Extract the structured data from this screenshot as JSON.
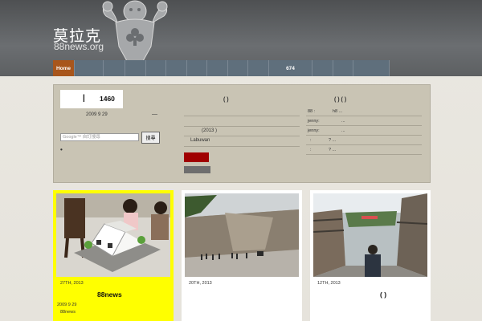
{
  "site": {
    "name_cn": "莫拉克",
    "name_en": "88news.org"
  },
  "nav": {
    "items": [
      {
        "label": "Home",
        "active": true
      },
      {
        "label": ""
      },
      {
        "label": ""
      },
      {
        "label": ""
      },
      {
        "label": ""
      },
      {
        "label": ""
      },
      {
        "label": ""
      },
      {
        "label": ""
      },
      {
        "label": ""
      },
      {
        "label": ""
      },
      {
        "label": "674"
      },
      {
        "label": ""
      },
      {
        "label": ""
      },
      {
        "label": ""
      }
    ]
  },
  "feature": {
    "counter_bar": "|",
    "counter_value": "1460",
    "date": "2009 9 29",
    "dash": "—",
    "search_placeholder": "Google™ 自訂搜尋",
    "search_button": "搜尋",
    "dot": "•",
    "mid_title": "(    )",
    "mid_line1": "(2013       )",
    "mid_line2": "Labuwan",
    "right_title": "(    ) (    )",
    "right_rows": [
      {
        "a": "88 :",
        "b": "h8 ..."
      },
      {
        "a": "jenny:",
        "b": "..."
      },
      {
        "a": "jenny:",
        "b": "..."
      },
      {
        "a": ":",
        "b": "? ..."
      },
      {
        "a": ":",
        "b": "? ..."
      }
    ]
  },
  "cards": [
    {
      "date": "27TH, 2013",
      "title": "88news",
      "meta_date": "2009 9 29",
      "meta_source": "88news",
      "highlight": true
    },
    {
      "date": "20TH, 2013",
      "title": ""
    },
    {
      "date": "12TH, 2013",
      "title": "(  )"
    }
  ],
  "colors": {
    "nav_bg": "#5f6f7c",
    "nav_home": "#a8561c",
    "feature_bg": "#c9c4b4",
    "highlight": "#ffff00",
    "red_button": "#a00000"
  }
}
